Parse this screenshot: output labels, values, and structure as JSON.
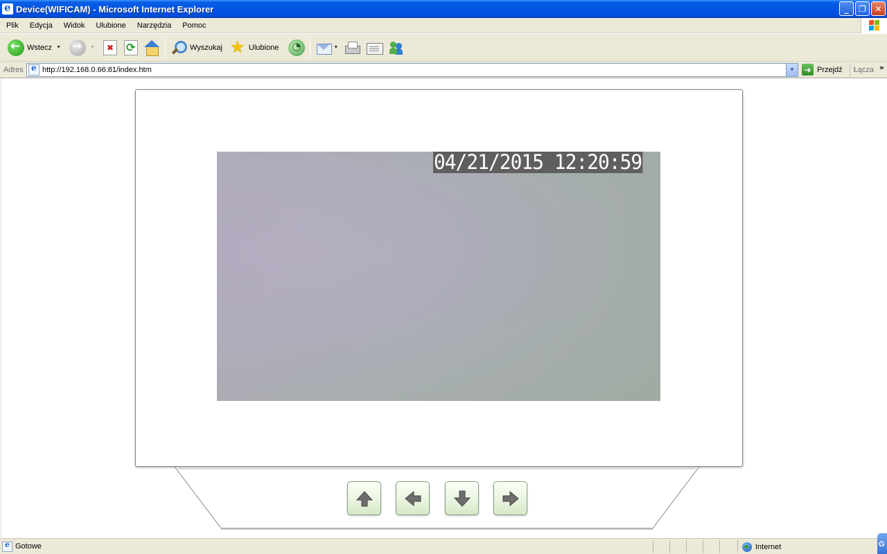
{
  "window": {
    "title": "Device(WIFICAM) - Microsoft Internet Explorer",
    "buttons": {
      "minimize": "_",
      "restore": "❐",
      "close": "✕"
    }
  },
  "menu": [
    "Plik",
    "Edycja",
    "Widok",
    "Ulubione",
    "Narzędzia",
    "Pomoc"
  ],
  "toolbar": {
    "back_label": "Wstecz",
    "search_label": "Wyszukaj",
    "favorites_label": "Ulubione",
    "icons": [
      "back-icon",
      "forward-icon",
      "stop-icon",
      "refresh-icon",
      "home-icon",
      "search-icon",
      "favorites-icon",
      "history-icon",
      "mail-icon",
      "print-icon",
      "edit-icon",
      "messenger-icon"
    ]
  },
  "address": {
    "label": "Adres",
    "url": "http://192.168.0.66:81/index.htm",
    "go_label": "Przejdź",
    "links_label": "Łącza",
    "links_chevron": "»"
  },
  "camera": {
    "timestamp": "04/21/2015 12:20:59"
  },
  "ptz": {
    "buttons": [
      "up",
      "left",
      "down",
      "right"
    ]
  },
  "status": {
    "text": "Gotowe",
    "zone": "Internet",
    "corner": "G"
  },
  "colors": {
    "titlebar": "#0054e3",
    "chrome": "#ece9d8",
    "ptz_button": "#eaf5e0",
    "video": "#aeadbc"
  }
}
